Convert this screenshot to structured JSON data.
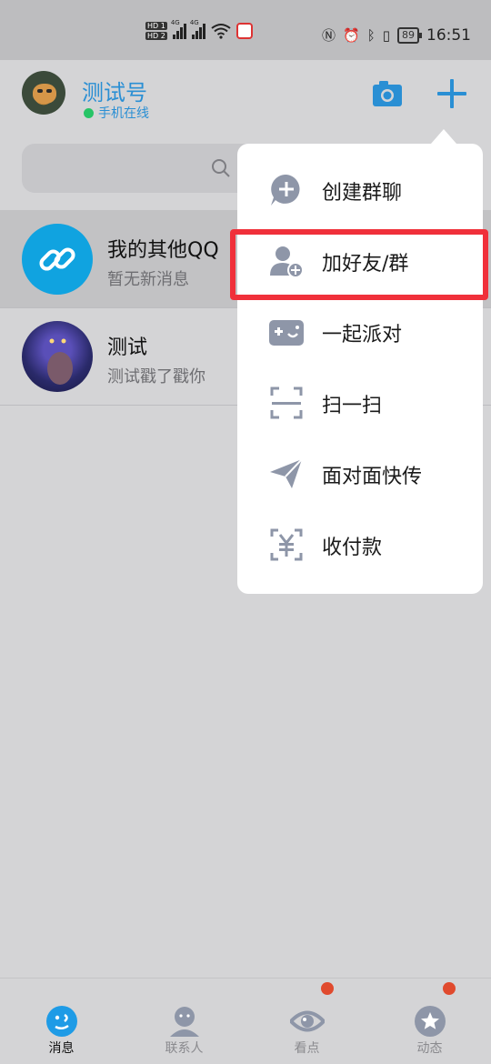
{
  "status_bar": {
    "hd_labels": [
      "HD 1",
      "HD 2"
    ],
    "network_labels": [
      "4G",
      "4G"
    ],
    "battery": "89",
    "time": "16:51"
  },
  "header": {
    "username": "测试号",
    "online_status": "手机在线"
  },
  "search": {
    "placeholder": ""
  },
  "chats": [
    {
      "name": "我的其他QQ",
      "message": "暂无新消息"
    },
    {
      "name": "测试",
      "message": "测试戳了戳你"
    }
  ],
  "menu": {
    "items": [
      {
        "label": "创建群聊",
        "icon": "create-group-icon"
      },
      {
        "label": "加好友/群",
        "icon": "add-friend-icon"
      },
      {
        "label": "一起派对",
        "icon": "party-icon"
      },
      {
        "label": "扫一扫",
        "icon": "scan-icon"
      },
      {
        "label": "面对面快传",
        "icon": "send-icon"
      },
      {
        "label": "收付款",
        "icon": "payment-icon"
      }
    ],
    "highlighted_item": "加好友/群"
  },
  "bottom_nav": {
    "tabs": [
      {
        "label": "消息",
        "icon": "message-icon",
        "active": true
      },
      {
        "label": "联系人",
        "icon": "contacts-icon",
        "active": false
      },
      {
        "label": "看点",
        "icon": "eye-icon",
        "active": false
      },
      {
        "label": "动态",
        "icon": "star-icon",
        "active": false
      }
    ]
  },
  "colors": {
    "accent": "#2a8fd4",
    "online": "#27c466",
    "highlight": "#f0303a",
    "badge": "#e04a2e",
    "menu_icon": "#8e96a8"
  }
}
